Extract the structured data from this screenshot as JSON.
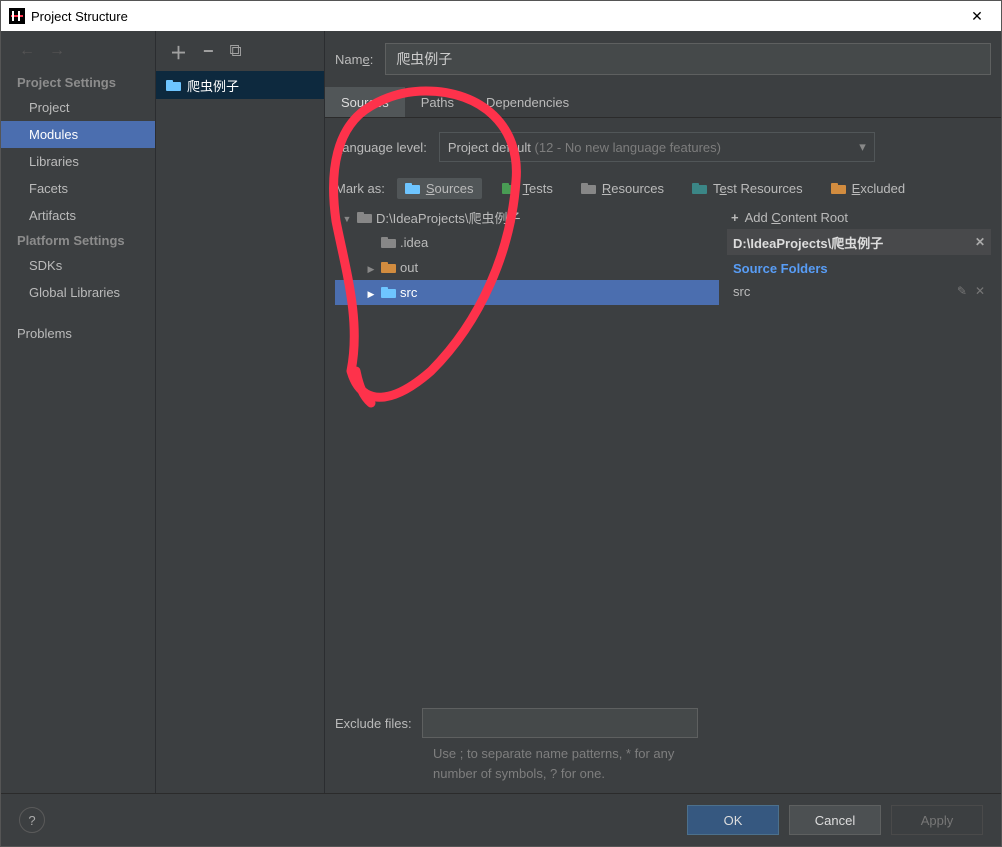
{
  "window": {
    "title": "Project Structure"
  },
  "nav": {
    "section1": "Project Settings",
    "items1": [
      "Project",
      "Modules",
      "Libraries",
      "Facets",
      "Artifacts"
    ],
    "section2": "Platform Settings",
    "items2": [
      "SDKs",
      "Global Libraries"
    ],
    "problems": "Problems",
    "selected": "Modules"
  },
  "modules": {
    "name": "爬虫例子"
  },
  "detail": {
    "name_label": "Name:",
    "name_value": "爬虫例子",
    "tabs": [
      "Sources",
      "Paths",
      "Dependencies"
    ],
    "active_tab": "Sources",
    "lang_label": "Language level:",
    "lang_value_prefix": "Project default ",
    "lang_value_dim": "(12 - No new language features)",
    "mark_label": "Mark as:",
    "marks": {
      "sources": "Sources",
      "tests": "Tests",
      "resources": "Resources",
      "test_resources": "Test Resources",
      "excluded": "Excluded"
    },
    "tree": [
      {
        "label": "D:\\IdeaProjects\\爬虫例子",
        "depth": 0,
        "arrow": "open",
        "color": "#878787",
        "selected": false
      },
      {
        "label": ".idea",
        "depth": 1,
        "arrow": "none",
        "color": "#878787",
        "selected": false
      },
      {
        "label": "out",
        "depth": 1,
        "arrow": "closed",
        "color": "#d28c3f",
        "selected": false
      },
      {
        "label": "src",
        "depth": 1,
        "arrow": "closed",
        "color": "#6ec5ff",
        "selected": true
      }
    ],
    "content_root": {
      "add_label": "Add Content Root",
      "path": "D:\\IdeaProjects\\爬虫例子",
      "source_folders_label": "Source Folders",
      "sources": [
        "src"
      ]
    },
    "exclude_label": "Exclude files:",
    "exclude_hint": "Use ; to separate name patterns, * for any number of symbols, ? for one."
  },
  "footer": {
    "ok": "OK",
    "cancel": "Cancel",
    "apply": "Apply"
  }
}
